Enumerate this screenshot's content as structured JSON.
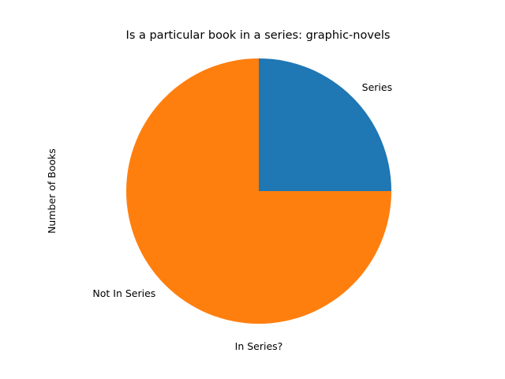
{
  "chart_data": {
    "type": "pie",
    "title": "Is a particular book in a series: graphic-novels",
    "xlabel": "In Series?",
    "ylabel": "Number of Books",
    "slices": [
      {
        "label": "Series",
        "value": 25,
        "color": "#1f77b4"
      },
      {
        "label": "Not In Series",
        "value": 75,
        "color": "#ff7f0e"
      }
    ],
    "start_angle_deg": 0,
    "direction": "counterclockwise",
    "legend": "none"
  }
}
